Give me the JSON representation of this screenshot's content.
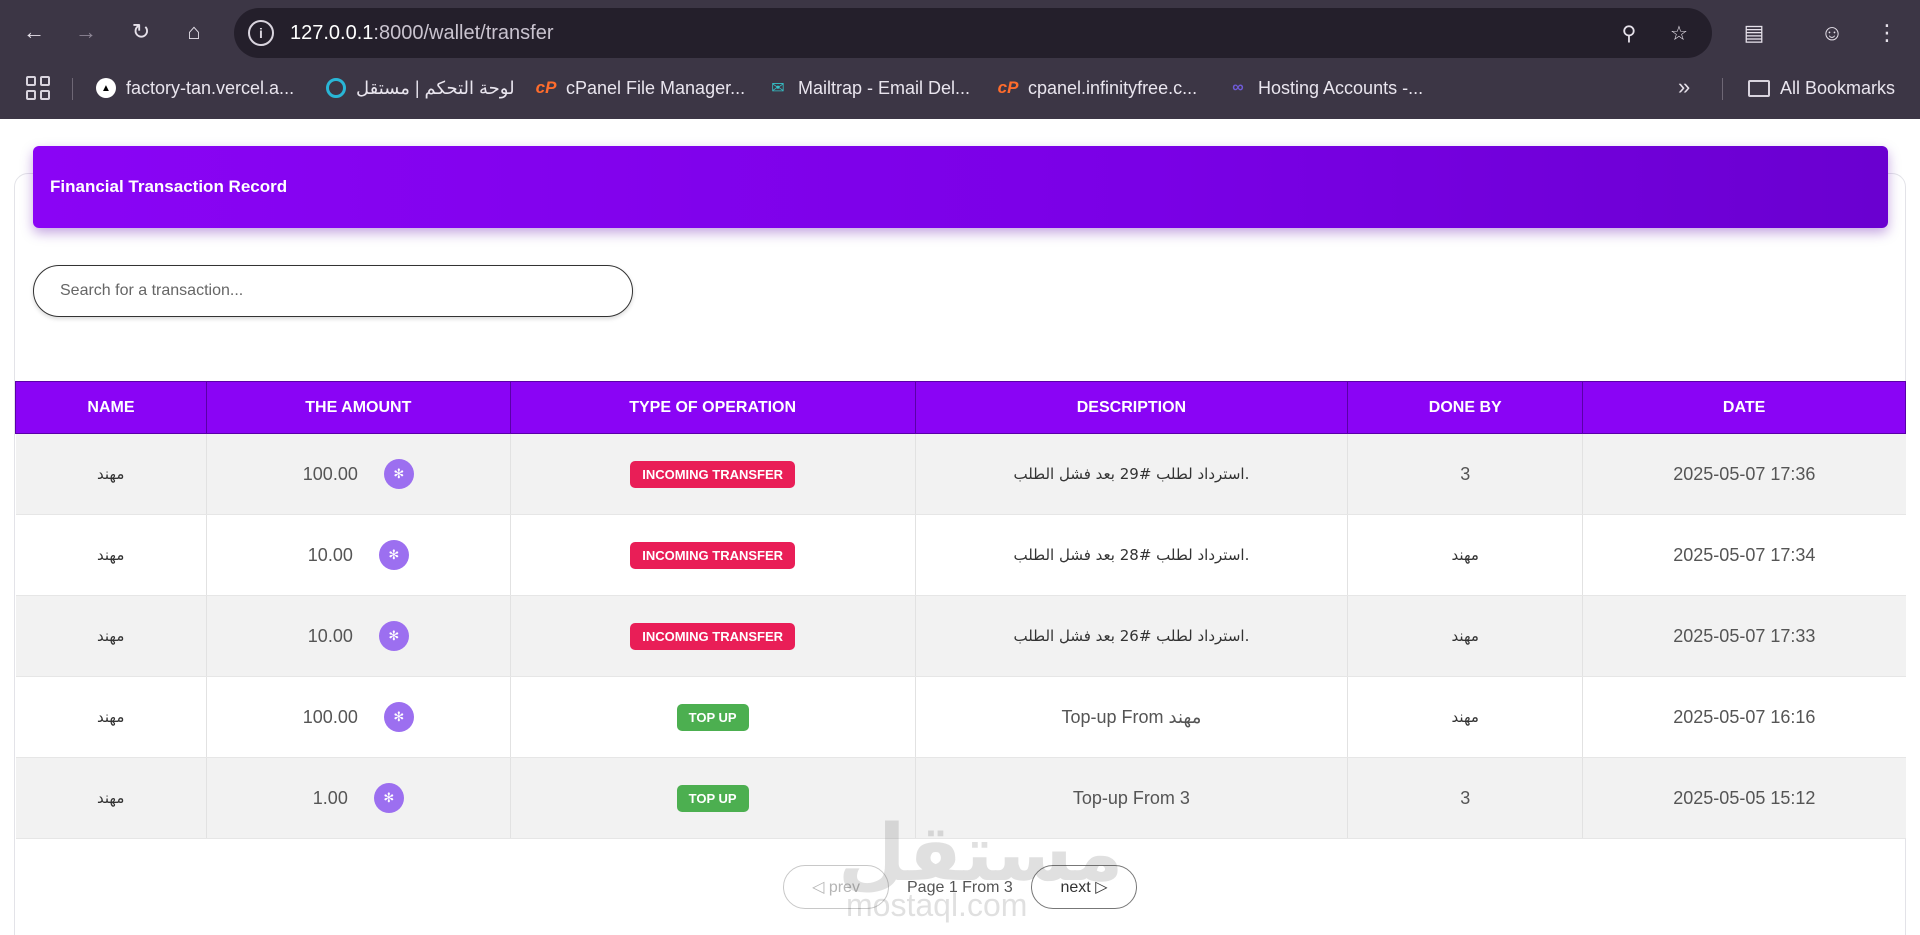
{
  "browser": {
    "url_host": "127.0.0.1",
    "url_path": ":8000/wallet/transfer",
    "bookmarks": [
      {
        "label": "factory-tan.vercel.a...",
        "icon": "vercel-icon"
      },
      {
        "label": "لوحة التحكم | مستقل",
        "icon": "ring-icon"
      },
      {
        "label": "cPanel File Manager...",
        "icon": "cpanel-icon"
      },
      {
        "label": "Mailtrap - Email Del...",
        "icon": "mailtrap-icon"
      },
      {
        "label": "cpanel.infinityfree.c...",
        "icon": "cpanel-icon"
      },
      {
        "label": "Hosting Accounts -...",
        "icon": "hosting-icon"
      }
    ],
    "all_bookmarks_label": "All Bookmarks"
  },
  "page": {
    "title": "Financial Transaction Record",
    "search_placeholder": "Search for a transaction...",
    "columns": [
      "NAME",
      "THE AMOUNT",
      "TYPE OF OPERATION",
      "DESCRIPTION",
      "DONE BY",
      "DATE"
    ],
    "rows": [
      {
        "name": "مهند",
        "amount": "100.00",
        "type": "INCOMING TRANSFER",
        "type_kind": "incoming",
        "description": "استرداد لطلب #29 بعد فشل الطلب.",
        "done_by": "3",
        "date": "2025-05-07 17:36"
      },
      {
        "name": "مهند",
        "amount": "10.00",
        "type": "INCOMING TRANSFER",
        "type_kind": "incoming",
        "description": "استرداد لطلب #28 بعد فشل الطلب.",
        "done_by": "مهند",
        "date": "2025-05-07 17:34"
      },
      {
        "name": "مهند",
        "amount": "10.00",
        "type": "INCOMING TRANSFER",
        "type_kind": "incoming",
        "description": "استرداد لطلب #26 بعد فشل الطلب.",
        "done_by": "مهند",
        "date": "2025-05-07 17:33"
      },
      {
        "name": "مهند",
        "amount": "100.00",
        "type": "TOP UP",
        "type_kind": "topup",
        "description": "Top-up From مهند",
        "done_by": "مهند",
        "date": "2025-05-07 16:16"
      },
      {
        "name": "مهند",
        "amount": "1.00",
        "type": "TOP UP",
        "type_kind": "topup",
        "description": "Top-up From 3",
        "done_by": "3",
        "date": "2025-05-05 15:12"
      }
    ],
    "pagination": {
      "prev_label": "◁ prev",
      "next_label": "next ▷",
      "info": "Page 1 From 3"
    },
    "watermark": {
      "main": "مستقل",
      "sub": "mostaql.com"
    }
  },
  "colors": {
    "header": "#8a04f5",
    "incoming": "#e91e57",
    "topup": "#4caf50",
    "coin": "#9c6ff0"
  }
}
